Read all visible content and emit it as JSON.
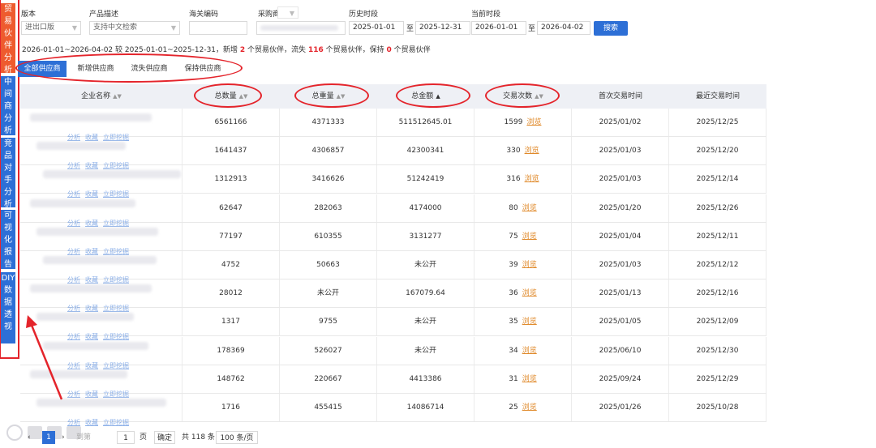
{
  "sidenav": {
    "items": [
      {
        "label": "贸易伙伴分析",
        "active": true
      },
      {
        "label": "中间商分析",
        "active": false
      },
      {
        "label": "竞品对手分析",
        "active": false
      },
      {
        "label": "可视化报告",
        "active": false
      },
      {
        "label": "DIY数据透视",
        "active": false
      }
    ]
  },
  "filters": {
    "version_label": "版本",
    "version_value": "进出口版",
    "product_label": "产品描述",
    "product_placeholder": "支持中文检索",
    "hscode_label": "海关编码",
    "buyer_label": "采购商",
    "history_label": "历史时段",
    "history_from": "2025-01-01",
    "history_sep": "至",
    "history_to": "2025-12-31",
    "current_label": "当前时段",
    "current_from": "2026-01-01",
    "current_sep": "至",
    "current_to": "2026-04-02",
    "search_button": "搜索"
  },
  "summary": {
    "text_a": "2026-01-01~2026-04-02 较 2025-01-01~2025-12-31，新增",
    "new_count": "2",
    "text_b": "个贸易伙伴，流失",
    "lost_count": "116",
    "text_c": "个贸易伙伴，保持",
    "kept_count": "0",
    "text_d": "个贸易伙伴"
  },
  "tabs": [
    {
      "label": "全部供应商",
      "active": true
    },
    {
      "label": "新增供应商",
      "active": false
    },
    {
      "label": "流失供应商",
      "active": false
    },
    {
      "label": "保持供应商",
      "active": false
    }
  ],
  "table": {
    "columns": [
      "企业名称",
      "总数量",
      "总重量",
      "总金额",
      "交易次数",
      "首次交易时间",
      "最近交易时间"
    ],
    "row_links": [
      "分析",
      "收藏",
      "立即挖掘"
    ],
    "browse_label": "浏览",
    "rows": [
      {
        "qty": "6561166",
        "weight": "4371333",
        "amount": "511512645.01",
        "count": "1599",
        "first": "2025/01/02",
        "last": "2025/12/25"
      },
      {
        "qty": "1641437",
        "weight": "4306857",
        "amount": "42300341",
        "count": "330",
        "first": "2025/01/03",
        "last": "2025/12/20"
      },
      {
        "qty": "1312913",
        "weight": "3416626",
        "amount": "51242419",
        "count": "316",
        "first": "2025/01/03",
        "last": "2025/12/14"
      },
      {
        "qty": "62647",
        "weight": "282063",
        "amount": "4174000",
        "count": "80",
        "first": "2025/01/20",
        "last": "2025/12/26"
      },
      {
        "qty": "77197",
        "weight": "610355",
        "amount": "3131277",
        "count": "75",
        "first": "2025/01/04",
        "last": "2025/12/11"
      },
      {
        "qty": "4752",
        "weight": "50663",
        "amount": "未公开",
        "count": "39",
        "first": "2025/01/03",
        "last": "2025/12/12"
      },
      {
        "qty": "28012",
        "weight": "未公开",
        "amount": "167079.64",
        "count": "36",
        "first": "2025/01/13",
        "last": "2025/12/16"
      },
      {
        "qty": "1317",
        "weight": "9755",
        "amount": "未公开",
        "count": "35",
        "first": "2025/01/05",
        "last": "2025/12/09"
      },
      {
        "qty": "178369",
        "weight": "526027",
        "amount": "未公开",
        "count": "34",
        "first": "2025/06/10",
        "last": "2025/12/30"
      },
      {
        "qty": "148762",
        "weight": "220667",
        "amount": "4413386",
        "count": "31",
        "first": "2025/09/24",
        "last": "2025/12/29"
      },
      {
        "qty": "1716",
        "weight": "455415",
        "amount": "14086714",
        "count": "25",
        "first": "2025/01/26",
        "last": "2025/10/28"
      }
    ]
  },
  "pager": {
    "prev": "‹",
    "page": "1",
    "next": "›",
    "goto_label": "到第",
    "goto_value": "1",
    "page_unit": "页",
    "confirm": "确定",
    "total": "共 118 条",
    "per_page": "100 条/页"
  }
}
